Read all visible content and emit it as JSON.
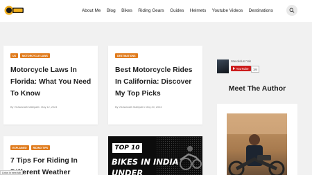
{
  "header": {
    "logo_text": "MOTO",
    "nav": [
      "About Me",
      "Blog",
      "Bikes",
      "Riding Gears",
      "Guides",
      "Helmets",
      "Youtube Videos",
      "Destinations"
    ]
  },
  "posts": [
    {
      "tags": [
        "US",
        "MOTORCYCLE LAWS"
      ],
      "title_lines": [
        "Motorcycle Laws In",
        "Florida: What You Need",
        "To Know"
      ],
      "meta": "By Vishwanath Mallipatil  •  May 12, 2024"
    },
    {
      "tags": [
        "DESTINATIONS"
      ],
      "title_lines": [
        "Best Motorcycle Rides",
        "In California: Discover",
        "My Top Picks"
      ],
      "meta": "By Vishwanath Mallipatil  •  May 20, 2024"
    },
    {
      "tags": [
        "EXPLAINED",
        "RIDING TIPS"
      ],
      "title_lines": [
        "7 Tips For Riding In",
        "Different Weather"
      ],
      "meta": ""
    }
  ],
  "promo": {
    "badge": "TOP 10",
    "line1": "BIKES IN INDIA",
    "line2": "UNDER"
  },
  "sidebar": {
    "youtube": {
      "channel_name": "Wanderlust Yah",
      "button": "YouTube",
      "count": "1M"
    },
    "author_heading": "Meet The Author"
  },
  "status_bar": {
    "text": "Links in new tab"
  },
  "colors": {
    "tag": "#e07b1c",
    "youtube": "#cc1c1c",
    "background": "#f1f1f1"
  }
}
